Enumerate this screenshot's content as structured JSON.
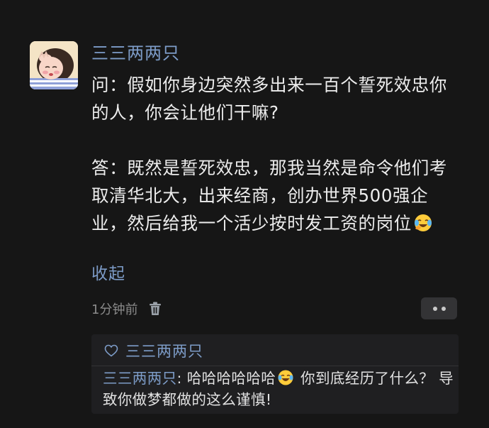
{
  "post": {
    "username": "三三两两只",
    "question": "问：假如你身边突然多出来一百个誓死效忠你的人，你会让他们干嘛?",
    "answer": "答：既然是誓死效忠，那我当然是命令他们考取清华北大，出来经商，创办世界500强企业，然后给我一个活少按时发工资的岗位",
    "answer_emoji": "laughing-crying-emoji",
    "collapse_label": "收起",
    "time": "1分钟前"
  },
  "likes": {
    "name": "三三两两只"
  },
  "reply": {
    "author": "三三两两只",
    "separator": ": ",
    "text_before": "哈哈哈哈哈哈",
    "text_after": " 你到底经历了什么？ 导致你做梦都做的这么谨慎!",
    "emoji": "tears-of-joy-emoji"
  },
  "colors": {
    "background": "#161616",
    "link": "#7d9cc8",
    "text": "#ededed",
    "muted": "#8b8b8b",
    "reply_bg": "#1f1f21"
  }
}
